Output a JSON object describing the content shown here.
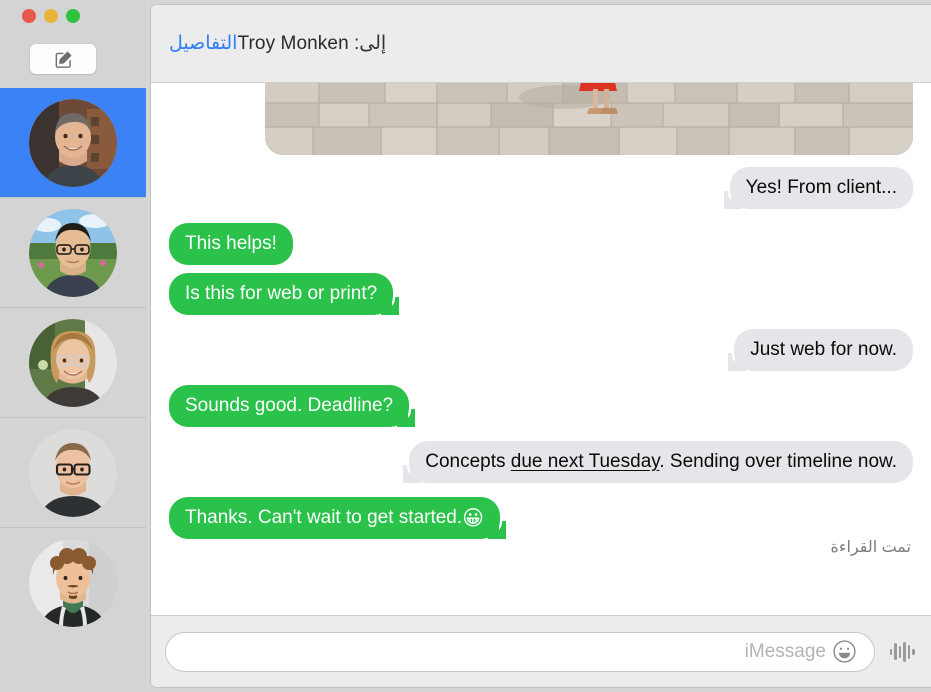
{
  "window": {
    "traffic_lights": [
      {
        "name": "zoom",
        "color": "#2fc23f"
      },
      {
        "name": "minimize",
        "color": "#e9b23c"
      },
      {
        "name": "close",
        "color": "#e8564c"
      }
    ],
    "compose_icon": "compose-pencil-icon"
  },
  "header": {
    "to_label": "إلى:",
    "recipient": "Troy Monken",
    "details_label": "التفاصيل",
    "details_color": "#2d7ef7"
  },
  "sidebar": {
    "conversations": [
      {
        "avatar": "avatar-man-gray-shirt",
        "selected": true,
        "selection_color": "#3b82f7"
      },
      {
        "avatar": "avatar-man-glasses-field",
        "selected": false
      },
      {
        "avatar": "avatar-woman-glasses-garden",
        "selected": false
      },
      {
        "avatar": "avatar-man-glasses-black-shirt",
        "selected": false
      },
      {
        "avatar": "avatar-man-curly-hoodie",
        "selected": false
      }
    ]
  },
  "conversation": {
    "attachment": {
      "kind": "photo",
      "description": "cobblestone-street-photo"
    },
    "messages": [
      {
        "id": "m1",
        "side": "incoming",
        "text": "Yes! From client...",
        "tail": true
      },
      {
        "id": "m2",
        "side": "outgoing",
        "text": "This helps!",
        "tail": false
      },
      {
        "id": "m3",
        "side": "outgoing",
        "text": "Is this for web or print?",
        "tail": true
      },
      {
        "id": "m4",
        "side": "incoming",
        "text": "Just web for now.",
        "tail": true
      },
      {
        "id": "m5",
        "side": "outgoing",
        "text": "Sounds good. Deadline?",
        "tail": true
      },
      {
        "id": "m6",
        "side": "incoming",
        "tail": true,
        "parts": [
          {
            "text": "Concepts "
          },
          {
            "text": "due next Tuesday",
            "underline": true
          },
          {
            "text": ". Sending over timeline now."
          }
        ]
      },
      {
        "id": "m7",
        "side": "outgoing",
        "tail": true,
        "parts": [
          {
            "text": "Thanks. Can't wait to get started."
          },
          {
            "text": "😀",
            "emoji": true
          }
        ]
      }
    ],
    "read_receipt": "تمت القراءة",
    "bubble_colors": {
      "incoming": "#e6e5ea",
      "outgoing": "#2ac24a",
      "incoming_text": "#0a0a0a",
      "outgoing_text": "#ffffff"
    }
  },
  "composer": {
    "audio_icon": "audio-waveform-icon",
    "emoji_icon": "smiley-face-icon",
    "input_value": "",
    "input_placeholder": "iMessage"
  }
}
